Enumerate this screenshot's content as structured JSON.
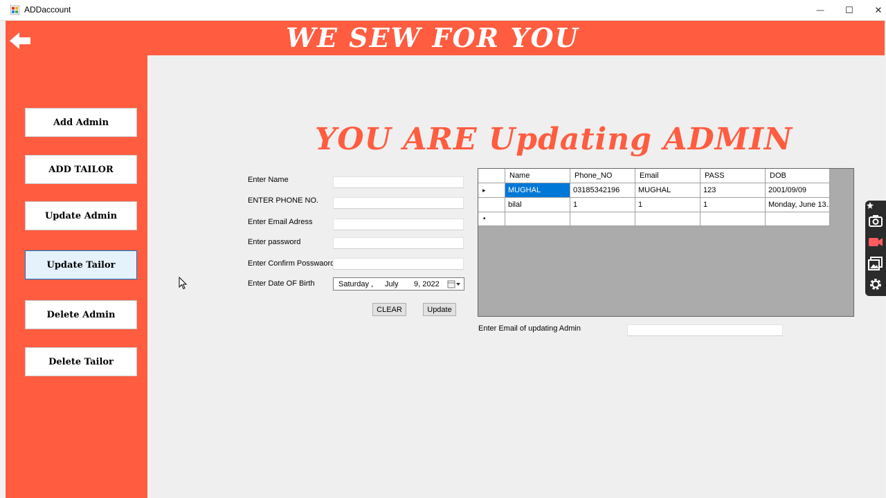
{
  "window": {
    "title": "ADDaccount",
    "minimize_glyph": "—",
    "maximize_glyph": "☐",
    "close_glyph": "✕"
  },
  "header": {
    "app_name": "WE SEW FOR YOU",
    "back_icon": "arrow-left-icon"
  },
  "sidebar": {
    "items": [
      {
        "label": "Add Admin"
      },
      {
        "label": "ADD TAILOR"
      },
      {
        "label": "Update Admin"
      },
      {
        "label": "Update Tailor"
      },
      {
        "label": "Delete Admin"
      },
      {
        "label": "Delete Tailor"
      }
    ]
  },
  "main": {
    "heading": "YOU ARE Updating ADMIN",
    "form": {
      "name_label": "Enter Name",
      "name_value": "",
      "phone_label": "ENTER PHONE NO.",
      "phone_value": "",
      "email_label": "Enter Email Adress",
      "email_value": "",
      "password_label": "Enter password",
      "password_value": "",
      "confirm_label": "Enter Confirm Posswaord",
      "confirm_value": "",
      "dob_label": "Enter Date OF Birth",
      "dob_day": "Saturday",
      "dob_sep": ",",
      "dob_month": "July",
      "dob_date": "9, 2022",
      "clear_label": "CLEAR",
      "update_label": "Update"
    },
    "grid": {
      "columns": [
        "Name",
        "Phone_NO",
        "Email",
        "PASS",
        "DOB"
      ],
      "rows": [
        [
          "MUGHAL",
          "03185342196",
          "MUGHAL",
          "123",
          "2001/09/09"
        ],
        [
          "bilal",
          "1",
          "1",
          "1",
          "Monday, June 13..."
        ]
      ],
      "current_row_marker": "▸",
      "new_row_marker": "•"
    },
    "search": {
      "label": "Enter Email of updating Admin",
      "value": ""
    }
  },
  "capture_toolbar": {
    "icons": [
      "camera-icon",
      "video-icon",
      "gallery-icon",
      "gear-icon"
    ]
  },
  "colors": {
    "accent": "#ff5c40",
    "background": "#efefef",
    "selection": "#0078d7"
  }
}
